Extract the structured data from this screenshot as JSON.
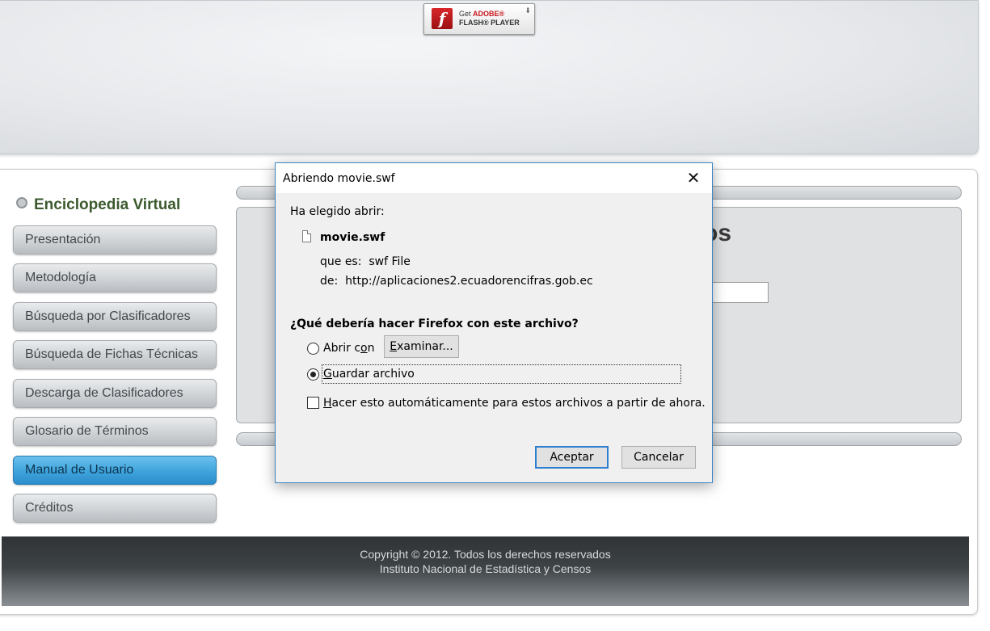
{
  "header": {
    "flash_badge": {
      "line1_prefix": "Get",
      "line1_brand": "ADOBE®",
      "line2": "FLASH® PLAYER",
      "logo_glyph": "f",
      "arrow_icon": "download-arrow-icon"
    }
  },
  "sidebar": {
    "title": "Enciclopedia Virtual",
    "items": [
      {
        "label": "Presentación"
      },
      {
        "label": "Metodología"
      },
      {
        "label": "Búsqueda por Clasificadores"
      },
      {
        "label": "Búsqueda de Fichas Técnicas"
      },
      {
        "label": "Descarga de Clasificadores"
      },
      {
        "label": "Glosario de Términos"
      },
      {
        "label": "Manual de Usuario",
        "active": true
      },
      {
        "label": "Créditos"
      }
    ]
  },
  "content": {
    "title_fragment": "os"
  },
  "footer": {
    "line1": "Copyright © 2012. Todos los derechos reservados",
    "line2": "Instituto Nacional de Estadística y Censos"
  },
  "dialog": {
    "title": "Abriendo movie.swf",
    "close_glyph": "✕",
    "intro": "Ha elegido abrir:",
    "file_name": "movie.swf",
    "type_label": "que es:",
    "type_value": "swf File",
    "from_label": "de:",
    "from_value": "http://aplicaciones2.ecuadorencifras.gob.ec",
    "question": "¿Qué debería hacer Firefox con este archivo?",
    "open_with": {
      "before": "Abrir c",
      "accel": "o",
      "after": "n"
    },
    "browse": {
      "accel": "E",
      "after": "xaminar..."
    },
    "save_file": {
      "accel": "G",
      "after": "uardar archivo",
      "selected": true
    },
    "auto": {
      "accel": "H",
      "after": "acer esto automáticamente para estos archivos a partir de ahora.",
      "checked": false
    },
    "ok_label": "Aceptar",
    "cancel_label": "Cancelar"
  },
  "colors": {
    "sidebar_title": "#3c5a2e",
    "active_nav": "#3fa4dc",
    "dialog_border": "#3a86c4"
  }
}
